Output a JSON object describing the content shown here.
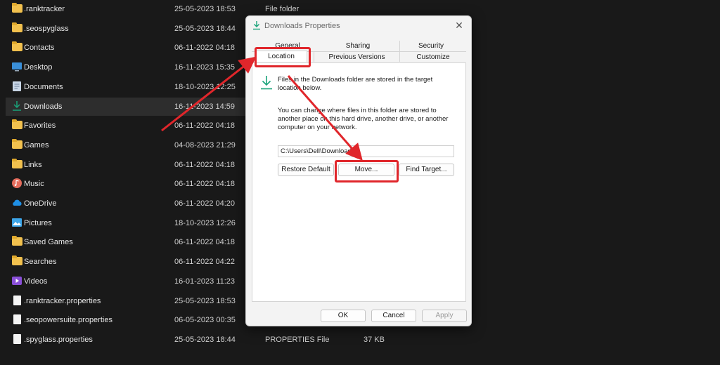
{
  "files": [
    {
      "name": ".ranktracker",
      "date": "25-05-2023 18:53",
      "type": "File folder",
      "size": "",
      "icon": "folder-icon",
      "selected": false
    },
    {
      "name": ".seospyglass",
      "date": "25-05-2023 18:44",
      "type": "",
      "size": "",
      "icon": "folder-icon",
      "selected": false
    },
    {
      "name": "Contacts",
      "date": "06-11-2022 04:18",
      "type": "",
      "size": "",
      "icon": "folder-icon",
      "selected": false
    },
    {
      "name": "Desktop",
      "date": "16-11-2023 15:35",
      "type": "",
      "size": "",
      "icon": "desktop-icon",
      "selected": false
    },
    {
      "name": "Documents",
      "date": "18-10-2023 12:25",
      "type": "",
      "size": "",
      "icon": "documents-icon",
      "selected": false
    },
    {
      "name": "Downloads",
      "date": "16-11-2023 14:59",
      "type": "",
      "size": "",
      "icon": "download-icon",
      "selected": true
    },
    {
      "name": "Favorites",
      "date": "06-11-2022 04:18",
      "type": "",
      "size": "",
      "icon": "folder-icon",
      "selected": false
    },
    {
      "name": "Games",
      "date": "04-08-2023 21:29",
      "type": "",
      "size": "",
      "icon": "folder-icon",
      "selected": false
    },
    {
      "name": "Links",
      "date": "06-11-2022 04:18",
      "type": "",
      "size": "",
      "icon": "folder-icon",
      "selected": false
    },
    {
      "name": "Music",
      "date": "06-11-2022 04:18",
      "type": "",
      "size": "",
      "icon": "music-icon",
      "selected": false
    },
    {
      "name": "OneDrive",
      "date": "06-11-2022 04:20",
      "type": "",
      "size": "",
      "icon": "cloud-icon",
      "selected": false
    },
    {
      "name": "Pictures",
      "date": "18-10-2023 12:26",
      "type": "",
      "size": "",
      "icon": "pictures-icon",
      "selected": false
    },
    {
      "name": "Saved Games",
      "date": "06-11-2022 04:18",
      "type": "",
      "size": "",
      "icon": "folder-icon",
      "selected": false
    },
    {
      "name": "Searches",
      "date": "06-11-2022 04:22",
      "type": "",
      "size": "",
      "icon": "folder-icon",
      "selected": false
    },
    {
      "name": "Videos",
      "date": "16-01-2023 11:23",
      "type": "",
      "size": "",
      "icon": "videos-icon",
      "selected": false
    },
    {
      "name": ".ranktracker.properties",
      "date": "25-05-2023 18:53",
      "type": "",
      "size": "",
      "icon": "file-icon",
      "selected": false
    },
    {
      "name": ".seopowersuite.properties",
      "date": "06-05-2023 00:35",
      "type": "",
      "size": "",
      "icon": "file-icon",
      "selected": false
    },
    {
      "name": ".spyglass.properties",
      "date": "25-05-2023 18:44",
      "type": "PROPERTIES File",
      "size": "37 KB",
      "icon": "file-icon",
      "selected": false
    }
  ],
  "dialog": {
    "title": "Downloads Properties",
    "close": "✕",
    "tabs": {
      "general": "General",
      "sharing": "Sharing",
      "security": "Security",
      "location": "Location",
      "previous_versions": "Previous Versions",
      "customize": "Customize"
    },
    "intro_line1": "Files in the Downloads folder are stored in the target",
    "intro_line2": "location below.",
    "change_line1": "You can change where files in this folder are stored to",
    "change_line2": "another place on this hard drive, another drive, or another",
    "change_line3": "computer on your network.",
    "path_value": "C:\\Users\\Dell\\Downloads",
    "restore_default": "Restore Default",
    "move": "Move...",
    "find_target": "Find Target...",
    "ok": "OK",
    "cancel": "Cancel",
    "apply": "Apply"
  },
  "colors": {
    "background": "#191919",
    "highlight": "#e0262b",
    "accent_green": "#1aa37a",
    "folder": "#f2c14e"
  }
}
